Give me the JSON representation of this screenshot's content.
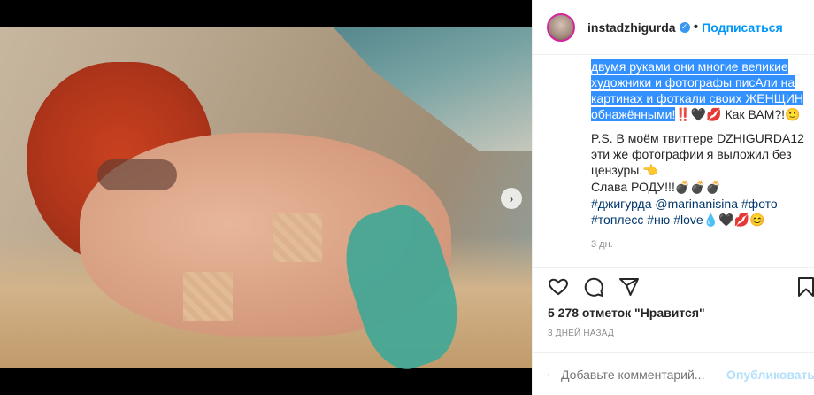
{
  "header": {
    "username": "instadzhigurda",
    "follow_label": "Подписаться"
  },
  "caption": {
    "highlighted_line1": "двумя руками они многие великие",
    "highlighted_line2": "художники и фотографы писАли на",
    "highlighted_line3": "картинах и фоткали своих ЖЕНЩИН",
    "highlighted_line4": "обнажёнными!",
    "trailing_text": "‼️🖤💋 Как ВАМ?!🙂",
    "ps_text": "P.S. В моём твиттере DZHIGURDA12 эти же фотографии я выложил без цензуры.👈",
    "glory_text": "Слава РОДУ!!!💣💣💣",
    "tags_line1_a": "#джигурда",
    "tags_line1_b": "@marinanisina",
    "tags_line1_c": "#фото",
    "tags_line2_a": "#топлесс",
    "tags_line2_b": "#ню",
    "tags_line2_c": "#love",
    "tags_line2_emoji": "💧🖤💋😊",
    "time_short": "3 дн."
  },
  "stats": {
    "likes_text": "5 278 отметок \"Нравится\"",
    "posted_ago": "3 ДНЕЙ НАЗАД"
  },
  "comment": {
    "placeholder": "Добавьте комментарий...",
    "publish_label": "Опубликовать"
  }
}
